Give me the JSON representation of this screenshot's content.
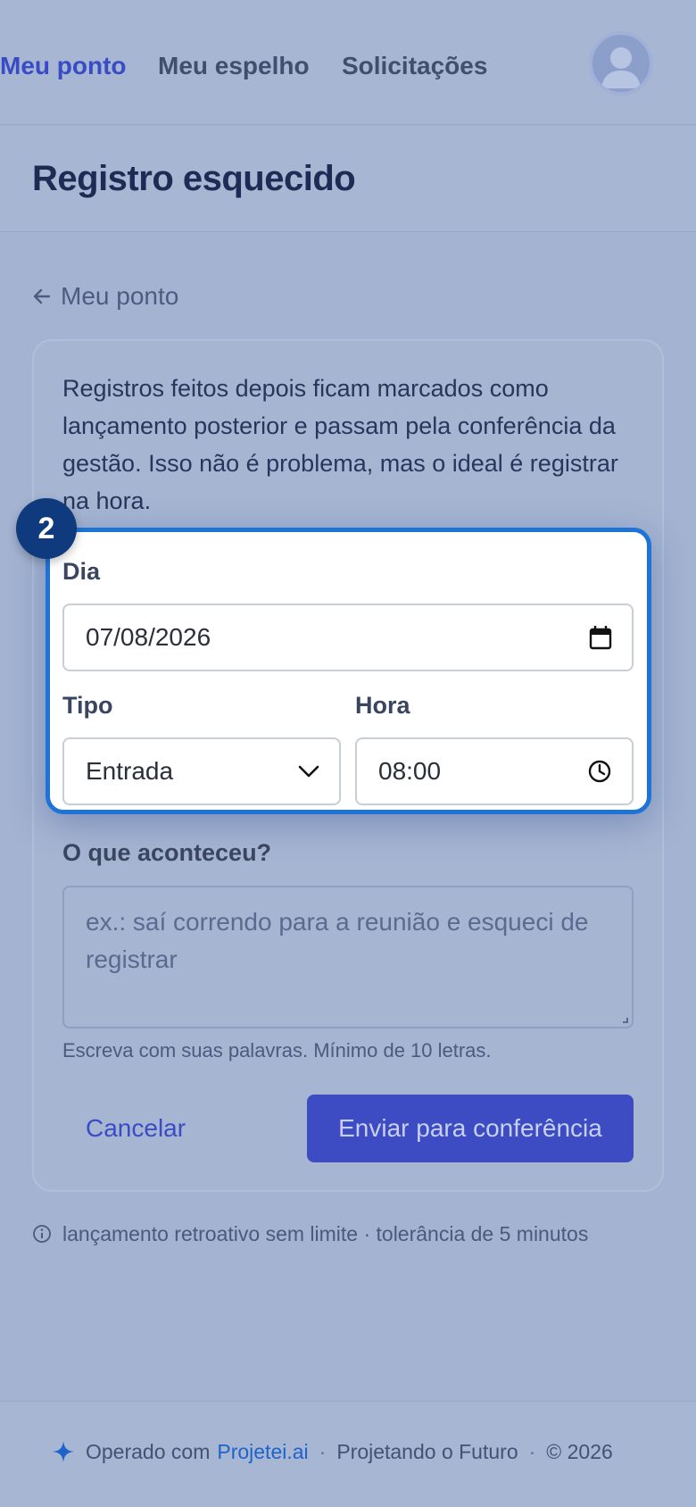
{
  "nav": {
    "items": [
      {
        "label": "Meu ponto",
        "active": true
      },
      {
        "label": "Meu espelho",
        "active": false
      },
      {
        "label": "Solicitações",
        "active": false
      }
    ],
    "avatar_icon": "user-avatar-icon"
  },
  "page": {
    "title": "Registro esquecido",
    "back_label": "Meu ponto"
  },
  "card": {
    "intro": "Registros feitos depois ficam marcados como lançamento posterior e passam pela conferência da gestão. Isso não é problema, mas o ideal é registrar na hora.",
    "step_number": "2",
    "fields": {
      "dia": {
        "label": "Dia",
        "value": "07/08/2026"
      },
      "tipo": {
        "label": "Tipo",
        "value": "Entrada"
      },
      "hora": {
        "label": "Hora",
        "value": "08:00"
      },
      "motivo": {
        "label": "O que aconteceu?",
        "placeholder": "ex.: saí correndo para a reunião e esqueci de registrar",
        "hint": "Escreva com suas palavras. Mínimo de 10 letras."
      }
    },
    "cancel_label": "Cancelar",
    "submit_label": "Enviar para conferência"
  },
  "footnote": "lançamento retroativo sem limite · tolerância de 5 minutos",
  "footer": {
    "prefix": "Operado com",
    "brand": "Projetei.ai",
    "tagline": "Projetando o Futuro",
    "copyright": "© 2026"
  },
  "colors": {
    "accent": "#3a4bc6",
    "highlight_border": "#1d74d6",
    "badge": "#0f3b7e"
  }
}
